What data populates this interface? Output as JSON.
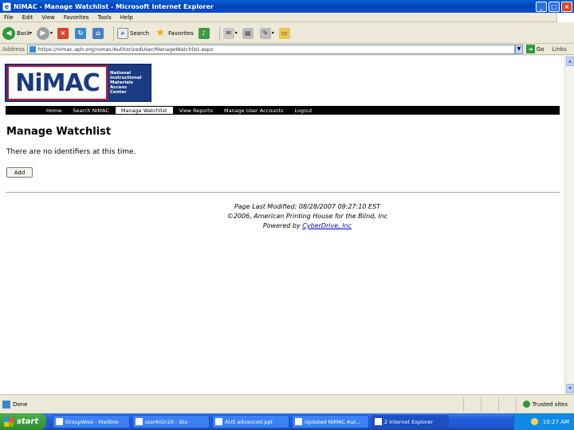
{
  "window": {
    "title": "NIMAC - Manage Watchlist - Microsoft Internet Explorer",
    "minimize": "_",
    "maximize": "□",
    "close": "×"
  },
  "menu": [
    "File",
    "Edit",
    "View",
    "Favorites",
    "Tools",
    "Help"
  ],
  "toolbar": {
    "back_label": "Back",
    "search_label": "Search",
    "favorites_label": "Favorites"
  },
  "address": {
    "label": "Address",
    "url": "https://nimac.aph.org/nimac/AuthorizedUser/ManageWatchlist.aspx",
    "go_label": "Go",
    "links_label": "Links"
  },
  "site": {
    "logo_text": "NiMAC",
    "org_name": [
      "National",
      "Instructional",
      "Materials",
      "Access",
      "Center"
    ],
    "nav": [
      "Home",
      "Search NIMAC",
      "Manage Watchlist",
      "View Reports",
      "Manage User Accounts",
      "Logout"
    ],
    "active_nav": "Manage Watchlist"
  },
  "page": {
    "title": "Manage Watchlist",
    "message": "There are no identifiers at this time.",
    "add_label": "Add"
  },
  "footer": {
    "last_modified": "Page Last Modified: 08/28/2007 09:27:10 EST",
    "copyright": "©2006, American Printing House for the Blind, Inc",
    "powered_prefix": "Powered by",
    "powered_link": "CyberDrive, Inc"
  },
  "status": {
    "text": "Done",
    "zone": "Trusted sites"
  },
  "taskbar": {
    "start_label": "start",
    "tasks": [
      {
        "label": "GroupWise - Mailbox",
        "active": false
      },
      {
        "label": "star602r20 - Sta",
        "active": false
      },
      {
        "label": "AUS advanced.ppt",
        "active": false
      },
      {
        "label": "Updated NIMAC Aut...",
        "active": false
      },
      {
        "label": "2 Internet Explorer",
        "active": true
      }
    ],
    "clock": "10:27 AM"
  },
  "colors": {
    "xp_blue": "#0a4fd0",
    "nav_bg": "#000000",
    "logo_blue": "#1a3a82",
    "logo_red": "#c8102e",
    "link": "#0000cc"
  }
}
